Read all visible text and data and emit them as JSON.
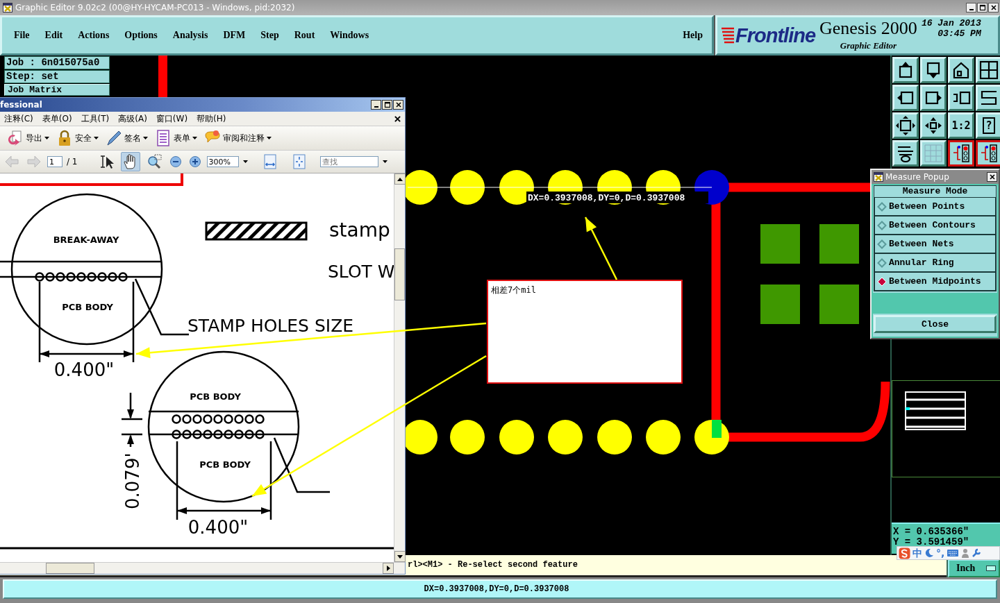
{
  "window": {
    "title": "Graphic Editor 9.02c2 (00@HY-HYCAM-PC013 - Windows, pid:2032)"
  },
  "menu": [
    "File",
    "Edit",
    "Actions",
    "Options",
    "Analysis",
    "DFM",
    "Step",
    "Rout",
    "Windows"
  ],
  "help": "Help",
  "brand": {
    "logo": "Frontline",
    "product": "Genesis 2000",
    "subtitle": "Graphic Editor",
    "date": "16 Jan 2013",
    "time": "03:45 PM"
  },
  "job": {
    "job": "Job :  6n015075a0",
    "step": "Step: set",
    "button": "Job Matrix"
  },
  "toolbox": [
    {
      "active": false
    },
    {
      "active": false
    },
    {
      "active": false
    },
    {
      "active": false
    },
    {
      "active": false
    },
    {
      "active": false
    },
    {
      "active": false
    },
    {
      "active": false
    },
    {
      "active": false
    },
    {
      "active": false
    },
    {
      "active": false,
      "label": "1:2"
    },
    {
      "active": false,
      "label": "?"
    },
    {
      "active": false
    },
    {
      "active": false
    },
    {
      "active": true
    },
    {
      "active": true
    }
  ],
  "canvas": {
    "measure_label": "DX=0.3937008,DY=0,D=0.3937008"
  },
  "note": {
    "text": "相差7个mil"
  },
  "pdf": {
    "title": "fessional",
    "menu": [
      "注释(C)",
      "表单(O)",
      "工具(T)",
      "高级(A)",
      "窗口(W)",
      "帮助(H)"
    ],
    "actions": [
      "导出",
      "安全",
      "签名",
      "表单",
      "审阅和注释"
    ],
    "page": "1",
    "page_total": "/ 1",
    "zoom": "300%",
    "search_placeholder": "查找",
    "tools": [
      {
        "selected": false
      },
      {
        "selected": true
      },
      {
        "selected": false
      }
    ],
    "drawing_labels": [
      "BREAK-AWAY",
      "PCB BODY",
      "stamp",
      "SLOT W",
      "STAMP HOLES SIZE",
      "0.400\"",
      "PCB BODY",
      "PCB BODY",
      "0.079'",
      "0.400\""
    ]
  },
  "measure_popup": {
    "title": "Measure Popup",
    "heading": "Measure Mode",
    "modes": [
      {
        "label": "Between Points",
        "selected": false
      },
      {
        "label": "Between Contours",
        "selected": false
      },
      {
        "label": "Between Nets",
        "selected": false
      },
      {
        "label": "Annular Ring",
        "selected": false
      },
      {
        "label": "Between Midpoints",
        "selected": true
      }
    ],
    "close": "Close"
  },
  "coords": {
    "x": "X = 0.635366\"",
    "y": "Y = 3.591459\""
  },
  "ime": {
    "mode": "中",
    "punct": "°,"
  },
  "prompt": "rl><M1> - Re-select second feature",
  "units": "Inch",
  "status": "DX=0.3937008,DY=0,D=0.3937008"
}
